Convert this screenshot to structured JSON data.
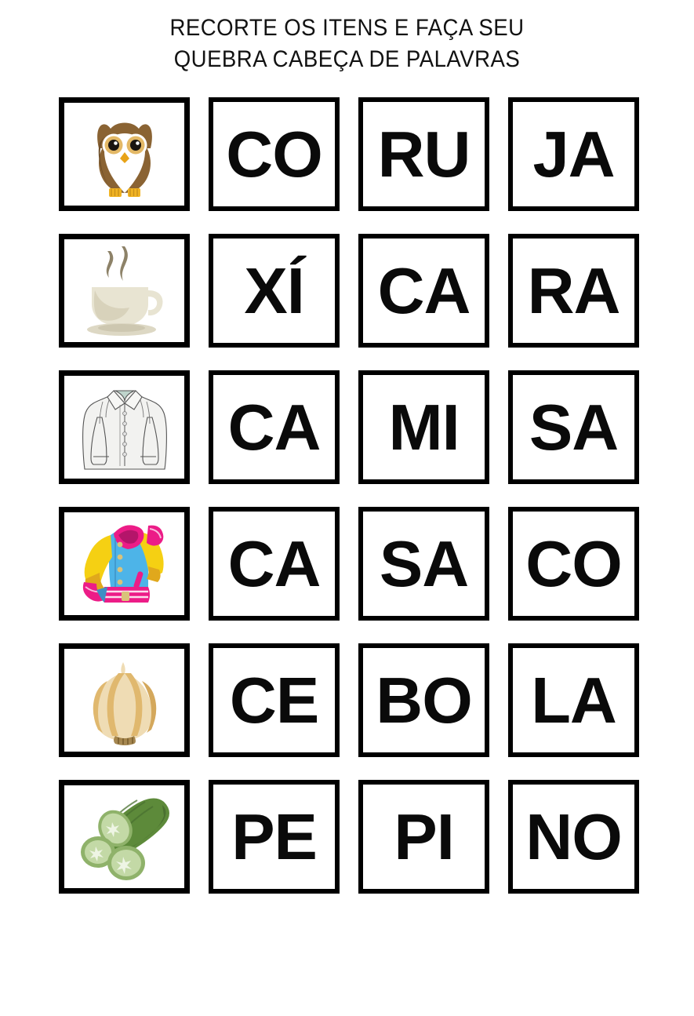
{
  "worksheet": {
    "title_line1": "RECORTE OS ITENS E FAÇA SEU",
    "title_line2": "QUEBRA CABEÇA DE PALAVRAS",
    "language": "pt-BR",
    "background_color": "#ffffff",
    "card_border_color": "#000000",
    "text_color": "#0a0a0a"
  },
  "rows": [
    {
      "word": "CORUJA",
      "picture_name": "owl-illustration",
      "syllables": [
        "CO",
        "RU",
        "JA"
      ],
      "picture_colors": {
        "body": "#8a6333",
        "body_light": "#a3783f",
        "face": "#ffffff",
        "eye_ring": "#e3b866",
        "pupil": "#1a1410",
        "beak": "#e8a317",
        "feet": "#f0b323"
      }
    },
    {
      "word": "XÍCARA",
      "picture_name": "coffee-cup-illustration",
      "syllables": [
        "XÍ",
        "CA",
        "RA"
      ],
      "picture_colors": {
        "cup": "#e8e4d2",
        "cup_shade": "#d8d2bb",
        "saucer": "#ddd8c4",
        "steam": "#8d8268"
      }
    },
    {
      "word": "CAMISA",
      "picture_name": "dress-shirt-illustration",
      "syllables": [
        "CA",
        "MI",
        "SA"
      ],
      "picture_colors": {
        "fabric": "#f2f2f0",
        "outline": "#4a4a4a",
        "collar_inner": "#bfd4cc",
        "buttons": "#d9d9d9"
      }
    },
    {
      "word": "CASACO",
      "picture_name": "varsity-jacket-illustration",
      "syllables": [
        "CA",
        "SA",
        "CO"
      ],
      "picture_colors": {
        "body": "#4db4e8",
        "sleeves": "#f5d013",
        "sleeve_shade": "#e0a81c",
        "trim": "#ec1c87",
        "trim_dark": "#b4156a",
        "buttons": "#d9c27a",
        "body_shade": "#3e8fc4"
      }
    },
    {
      "word": "CEBOLA",
      "picture_name": "onion-illustration",
      "syllables": [
        "CE",
        "BO",
        "LA"
      ],
      "picture_colors": {
        "bulb": "#efdcb4",
        "stripe": "#e0b86e",
        "stripe_dark": "#d4a85c",
        "roots": "#9c7b3f"
      }
    },
    {
      "word": "PEPINO",
      "picture_name": "cucumber-illustration",
      "syllables": [
        "PE",
        "PI",
        "NO"
      ],
      "picture_colors": {
        "skin": "#5d8a3a",
        "skin_dark": "#4a7030",
        "slice": "#aecb8b",
        "slice_rim": "#8fb26a",
        "flesh": "#c3d9a6",
        "seeds": "#eef5e4"
      }
    }
  ]
}
